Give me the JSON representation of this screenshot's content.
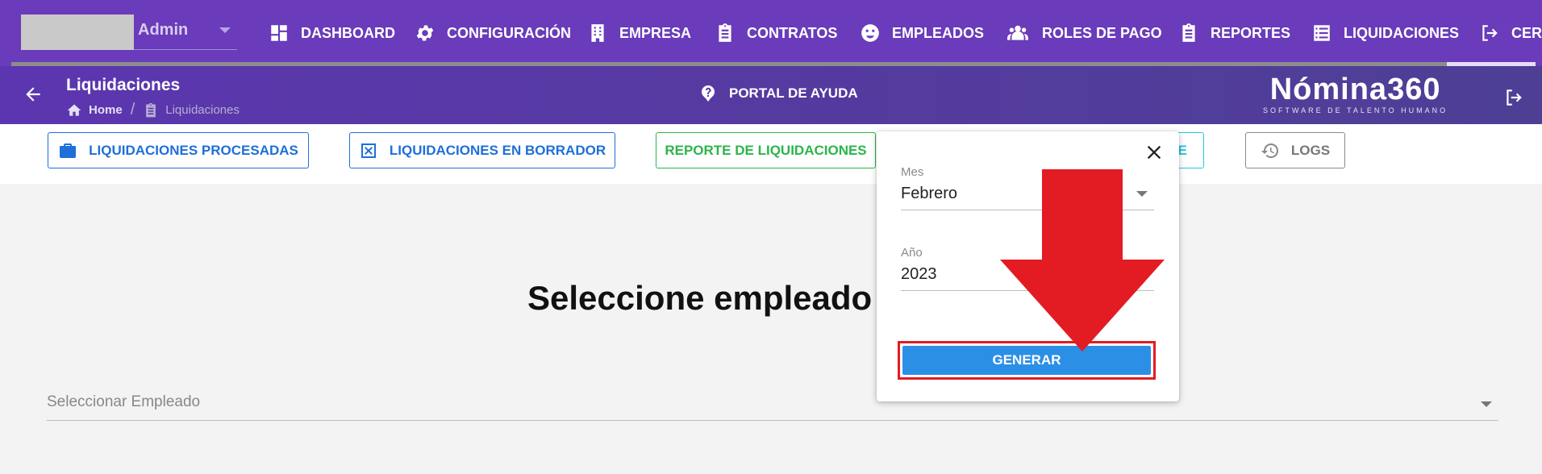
{
  "user": {
    "name": "Admin"
  },
  "nav": {
    "items": [
      {
        "label": "DASHBOARD",
        "icon": "dashboard-icon"
      },
      {
        "label": "CONFIGURACIÓN",
        "icon": "gear-icon"
      },
      {
        "label": "EMPRESA",
        "icon": "building-icon"
      },
      {
        "label": "CONTRATOS",
        "icon": "clipboard-icon"
      },
      {
        "label": "EMPLEADOS",
        "icon": "face-icon"
      },
      {
        "label": "ROLES DE PAGO",
        "icon": "group-icon"
      },
      {
        "label": "REPORTES",
        "icon": "clipboard-icon"
      },
      {
        "label": "LIQUIDACIONES",
        "icon": "list-icon"
      },
      {
        "label": "CER",
        "icon": "logout-icon"
      }
    ]
  },
  "header": {
    "title": "Liquidaciones",
    "breadcrumb_home": "Home",
    "breadcrumb_sep": "/",
    "breadcrumb_current": "Liquidaciones",
    "help_label": "PORTAL DE AYUDA",
    "brand_name": "Nómina360",
    "brand_tagline": "SOFTWARE DE TALENTO HUMANO"
  },
  "actions": {
    "processed": "LIQUIDACIONES PROCESADAS",
    "drafts": "LIQUIDACIONES EN BORRADOR",
    "report": "REPORTE DE LIQUIDACIONES",
    "partial": "E",
    "logs": "LOGS"
  },
  "main": {
    "heading": "Seleccione empleado a",
    "employee_placeholder": "Seleccionar Empleado"
  },
  "modal": {
    "month_label": "Mes",
    "month_value": "Febrero",
    "year_label": "Año",
    "year_value": "2023",
    "generate_label": "GENERAR"
  },
  "colors": {
    "nav_bg": "#6a3bba",
    "primary": "#1e6fd9",
    "success": "#2bb54a",
    "info": "#29c4e0",
    "generate": "#2b8fe6",
    "annotation": "#e31b23"
  }
}
